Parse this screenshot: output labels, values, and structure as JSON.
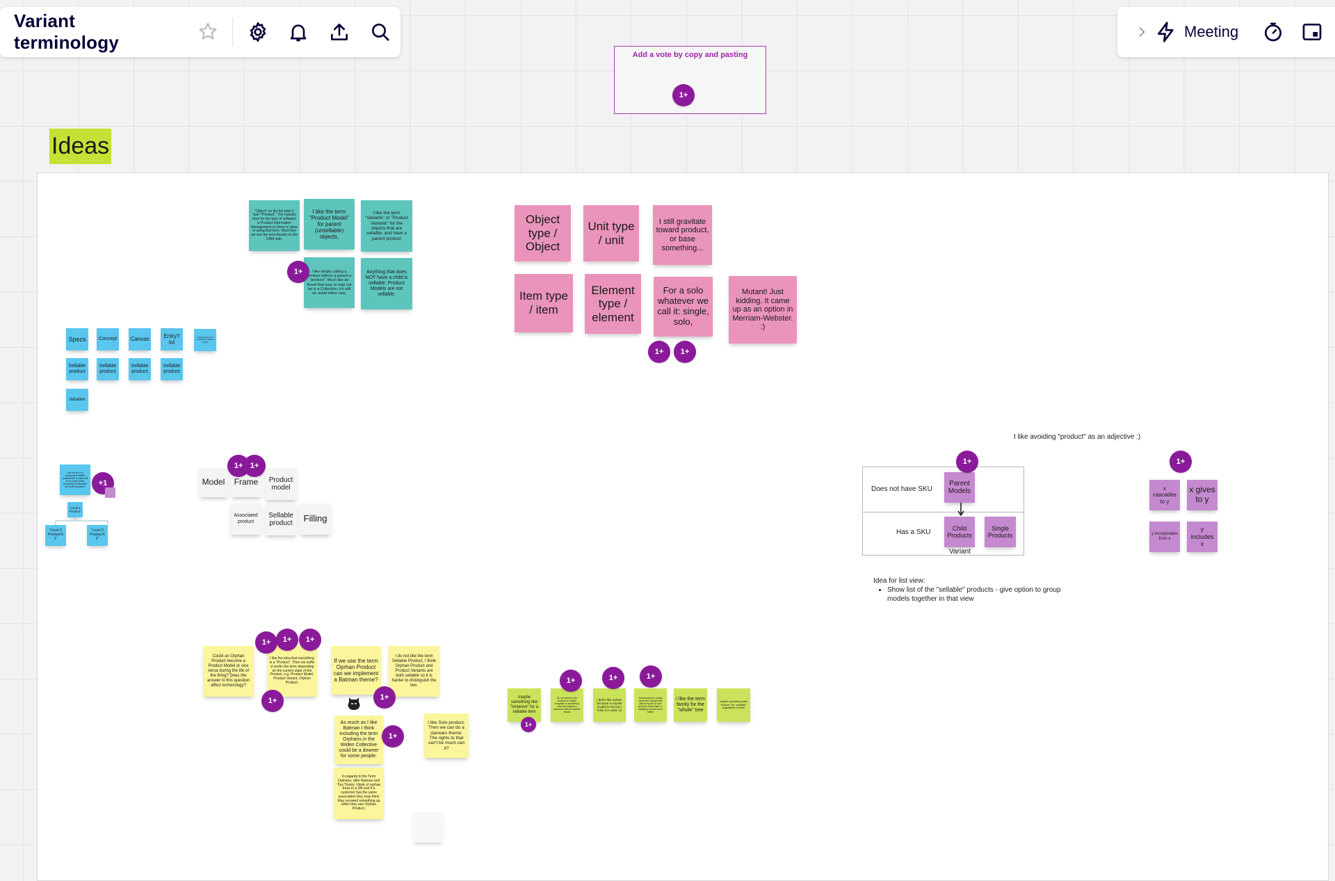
{
  "toolbar": {
    "board_title": "Variant terminology",
    "icons": [
      "star-icon",
      "gear-icon",
      "bell-icon",
      "upload-icon",
      "search-icon"
    ],
    "meeting_label": "Meeting"
  },
  "vote_frame": {
    "title": "Add a vote by copy and pasting",
    "vote_label": "1+"
  },
  "ideas_title": "Ideas",
  "teal_notes": [
    "\"Object\" on the list view (I \"ask\" \"Product\". The industry term for the type of software is Product Information Management so there is value in using that term. Much like we use the term Assets on the DAM side.",
    "I like the term \"Product Model\" for parent (unsellable) objects.",
    "I like the term \"Variants\" or \"Product Variants\" for the objects that are sellable, and have a parent product",
    "I like simply calling a product without a parent a \"product\". Much like an Asset that may or may not be in a Collection, it's still an asset either way.",
    "Anything that does NOT have a child is sellable. Product Models are not sellable."
  ],
  "pink_notes": [
    "Object type / Object",
    "Unit type / unit",
    "I still gravitate toward product, or base something...",
    "Item type / item",
    "Element type / element",
    "For a solo whatever we call it: single, solo,",
    "Mutant! Just kidding. It came up as an option in Merriam-Webster. :)"
  ],
  "blue_notes": [
    "Specs",
    "Concept",
    "Canvas",
    "Entry? lol",
    "Cookie-butters of products to make a 'brand'",
    "Sellable product",
    "Sellable product",
    "Sellable product",
    "Sellable product",
    "Variation"
  ],
  "tree_notes": [
    "Can we do in a component similar (nested and we just call it our component hierarchy) to describe our level structure?",
    "\"Level 1 Product\"",
    "\"Level 2 Product A 1\"",
    "\"Level 2 Product A 2\""
  ],
  "gray_notes": [
    "Model",
    "Frame",
    "Product model",
    "Associated product",
    "Sellable product",
    "Filling"
  ],
  "yellow_notes": [
    "Could an Orphan Product become a Product Model or vice versa during the life of the thing? Does the answer to this question affect terminology?",
    "I like the idea that everything is a \"Product\". Then we suffix or prefix the term depending on the current state of the Product. e.g. Product Model, Product Variant, Orphan Product.",
    "If we use the term Oprhan Product can we implement a Batman theme?",
    "I do not like the term Sellable Product, I think Orphan Product and Product Variants are both sellable so it is harder to distinguish the two.",
    "As much as I like Batman I think including the term Orphans in the Widen Collective could be a downer for some people.",
    "I like Solo product. Then we can do a starwars theme. The rights to that can't be much can it?",
    "In regards to the Term Orphans, after Batman and Tiny Timmy I think of orphan trees in a DB and if a customer has the same association they may think they screwed something up when they see Orphan Product."
  ],
  "lime_notes": [
    "maybe something like \"instance\" for a sellable item",
    "Do we need to use product or maybe template or something else that implies a structure without specific values",
    "I didn't like orphan because it sounds invalid to me but I think it is valid. lol",
    "Solo/a parent is pretty clear the it single kind (since my tier of how going to invest later or category and all seem better",
    "I like the term family for the \"whole\" tree",
    "maybe something with \"known\" for \"sellable\" regardless of level"
  ],
  "sku_table": {
    "row1_label": "Does not have SKU",
    "row2_label": "Has a SKU",
    "parent": "Parent Models",
    "child": "Child Products",
    "single": "Single Products",
    "variant_label": "Variant"
  },
  "adjective_note": "I like avoiding \"product\" as an adjective :)",
  "violet_notes": [
    "x cascades to y",
    "x gives to y",
    "y incorporates from x",
    "y includes x"
  ],
  "list_view": {
    "title": "Idea for list view:",
    "bullet": "Show list of the \"sellable\" products - give option to group models together in that view"
  },
  "votes": {
    "plus_one": "1+",
    "one_plus": "+1"
  },
  "colors": {
    "accent_purple": "#8a1a9a",
    "ideas_highlight": "#c6e035",
    "teal": "#5ec5bd",
    "pink": "#ea94bb",
    "blue": "#59c6ee",
    "yellow": "#fbf59b",
    "lime": "#cae35a",
    "violet": "#c589cf"
  }
}
